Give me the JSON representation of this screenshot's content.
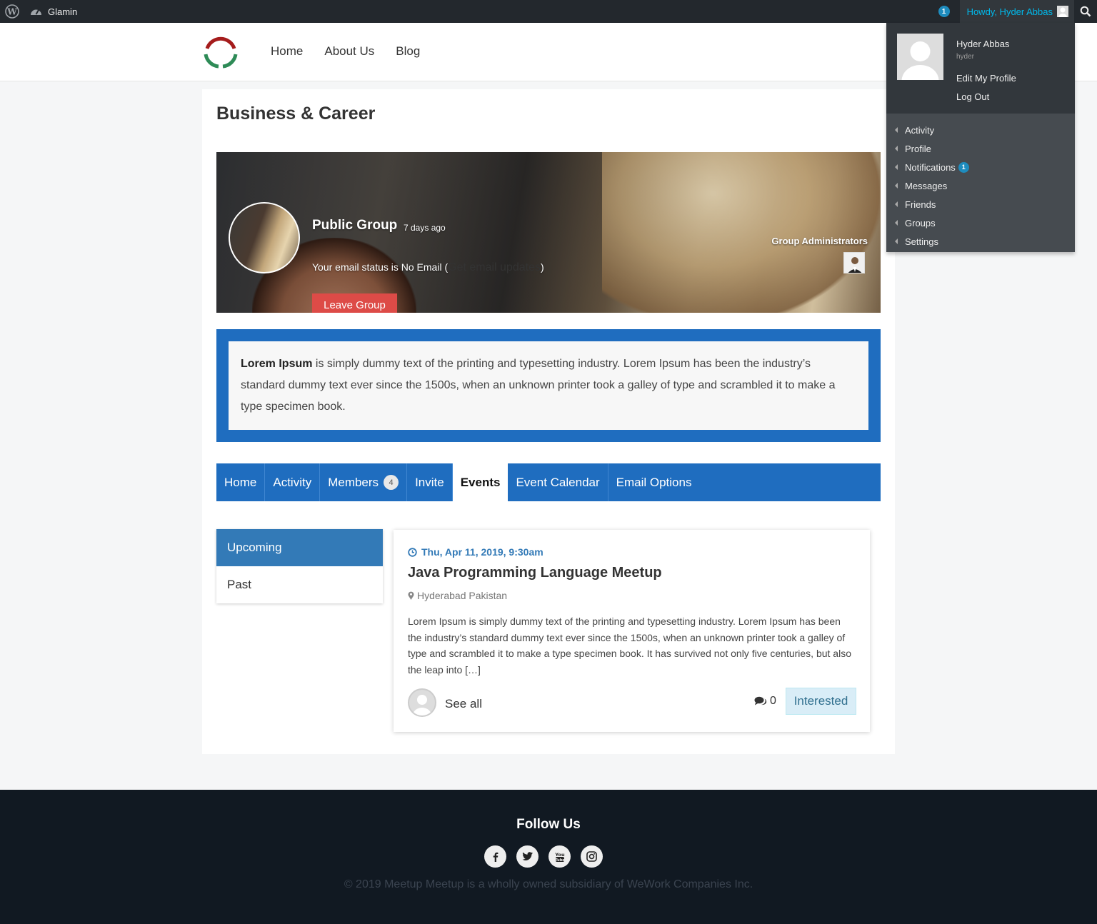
{
  "adminbar": {
    "site_name": "Glamin",
    "notification_count": "1",
    "howdy": "Howdy, Hyder Abbas"
  },
  "user_menu": {
    "display_name": "Hyder Abbas",
    "login": "hyder",
    "edit_profile": "Edit My Profile",
    "logout": "Log Out",
    "items": [
      {
        "label": "Activity"
      },
      {
        "label": "Profile"
      },
      {
        "label": "Notifications",
        "badge": "1"
      },
      {
        "label": "Messages"
      },
      {
        "label": "Friends"
      },
      {
        "label": "Groups"
      },
      {
        "label": "Settings"
      }
    ]
  },
  "nav": {
    "items": [
      "Home",
      "About Us",
      "Blog"
    ]
  },
  "page": {
    "title": "Business & Career"
  },
  "group": {
    "type": "Public Group",
    "active_ago": "7 days ago",
    "email_status_prefix": "Your email status is No Email (",
    "email_link": "Get email updates",
    "email_status_suffix": ")",
    "leave_button": "Leave Group",
    "admins_label": "Group Administrators",
    "description_bold": "Lorem Ipsum",
    "description_rest": " is simply dummy text of the printing and typesetting industry. Lorem Ipsum has been the industry’s standard dummy text ever since the 1500s, when an unknown printer took a galley of type and scrambled it to make a type specimen book."
  },
  "tabs": [
    {
      "label": "Home"
    },
    {
      "label": "Activity"
    },
    {
      "label": "Members",
      "count": "4"
    },
    {
      "label": "Invite"
    },
    {
      "label": "Events",
      "active": true
    },
    {
      "label": "Event Calendar"
    },
    {
      "label": "Email Options"
    }
  ],
  "filters": {
    "upcoming": "Upcoming",
    "past": "Past"
  },
  "event": {
    "date": "Thu, Apr 11, 2019, 9:30am",
    "title": "Java Programming Language Meetup",
    "location": "Hyderabad Pakistan",
    "description": "Lorem Ipsum is simply dummy text of the printing and typesetting industry. Lorem Ipsum has been the industry’s standard dummy text ever since the 1500s, when an unknown printer took a galley of type and scrambled it to make a type specimen book. It has survived not only five centuries, but also the leap into […]",
    "see_all": "See all",
    "comment_count": "0",
    "interested_button": "Interested"
  },
  "footer": {
    "follow_us": "Follow Us",
    "copyright": "© 2019 Meetup Meetup is a wholly owned subsidiary of WeWork Companies Inc.",
    "socials": [
      "facebook-icon",
      "twitter-icon",
      "youtube-icon",
      "instagram-icon"
    ]
  },
  "colors": {
    "primary_blue": "#1f6dbf",
    "leave_red": "#dd4b47",
    "adminbar": "#23282d",
    "footer": "#111922"
  }
}
